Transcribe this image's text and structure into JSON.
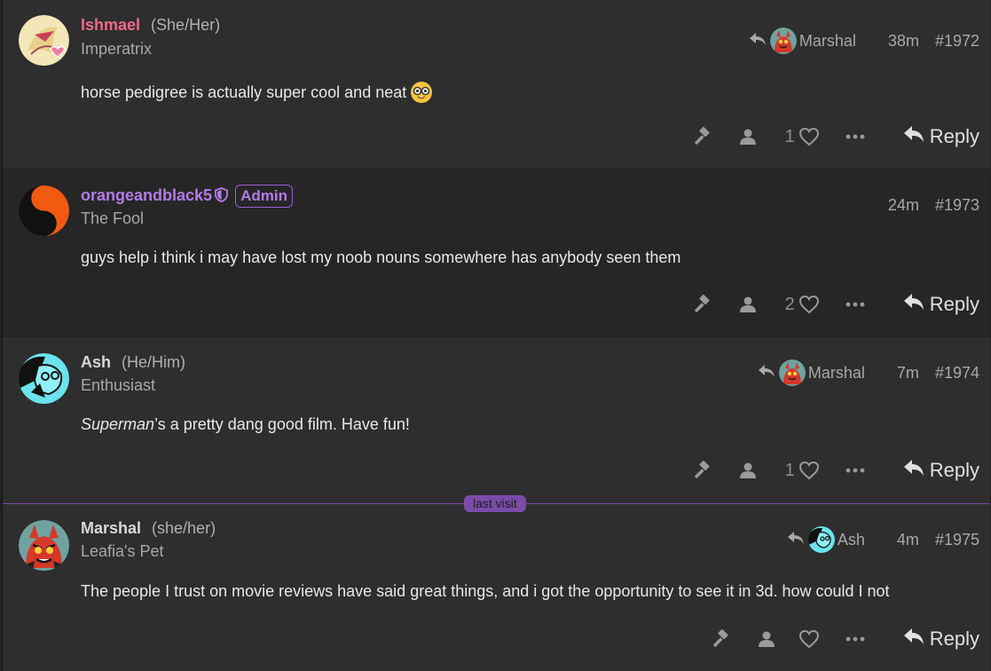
{
  "posts": [
    {
      "username": "Ishmael",
      "pronouns": "(She/Her)",
      "user_title": "Imperatrix",
      "reply_to": "Marshal",
      "age": "38m",
      "number": "#1972",
      "content": "horse pedigree is actually super cool and neat",
      "emoji": "nerd-face-emoji",
      "like_count": "1",
      "reply_label": "Reply",
      "name_color": "#f06a8a"
    },
    {
      "username": "orangeandblack5",
      "badge": "Admin",
      "user_title": "The Fool",
      "age": "24m",
      "number": "#1973",
      "content": "guys help i think i may have lost my noob nouns somewhere has anybody seen them",
      "like_count": "2",
      "reply_label": "Reply",
      "name_color": "#b37be8"
    },
    {
      "username": "Ash",
      "pronouns": "(He/Him)",
      "user_title": "Enthusiast",
      "reply_to": "Marshal",
      "age": "7m",
      "number": "#1974",
      "content_italic": "Superman",
      "content_rest": "’s a pretty dang good film. Have fun!",
      "like_count": "1",
      "reply_label": "Reply",
      "name_color": "#d8d8d8"
    },
    {
      "username": "Marshal",
      "pronouns": "(she/her)",
      "user_title": "Leafia's Pet",
      "reply_to": "Ash",
      "age": "4m",
      "number": "#1975",
      "content": "The people I trust on movie reviews have said great things, and i got the opportunity to see it in 3d. how could I not",
      "like_count": "",
      "reply_label": "Reply",
      "name_color": "#d8d8d8"
    }
  ],
  "divider_label": "last visit",
  "colors": {
    "background": "#2e2e2e",
    "shaded_background": "#262626",
    "admin_accent": "#b37be8",
    "last_visit_line": "#7b4ba8"
  },
  "icons": [
    "reply-arrow-icon",
    "hammer-icon",
    "user-icon",
    "heart-icon",
    "ellipsis-icon",
    "shield-icon"
  ]
}
